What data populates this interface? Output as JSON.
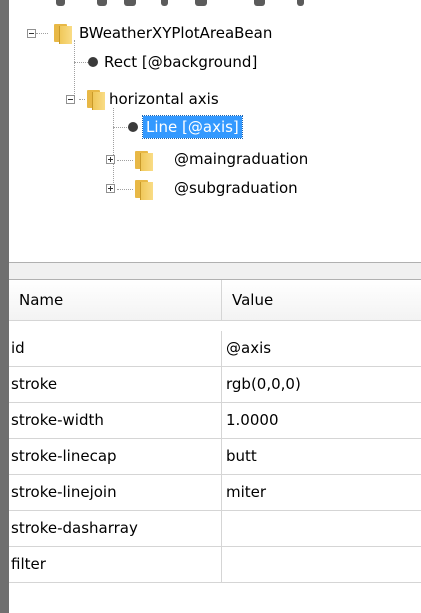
{
  "tree": {
    "nodes": [
      {
        "label": "BWeatherXYPlotAreaBean",
        "icon": "folder-icon",
        "toggle": "minus",
        "selected": false
      },
      {
        "label": "Rect [@background]",
        "icon": "leaf-dot-icon",
        "toggle": "none",
        "selected": false
      },
      {
        "label": "horizontal axis",
        "icon": "folder-icon",
        "toggle": "minus",
        "selected": false
      },
      {
        "label": "Line [@axis]",
        "icon": "leaf-dot-icon",
        "toggle": "none",
        "selected": true
      },
      {
        "label": "@maingraduation",
        "icon": "folder-icon",
        "toggle": "plus",
        "selected": false
      },
      {
        "label": "@subgraduation",
        "icon": "folder-icon",
        "toggle": "plus",
        "selected": false
      }
    ],
    "selection_color": "#3399ff",
    "folder_color": "#f0c85a"
  },
  "properties": {
    "columns": {
      "name": "Name",
      "value": "Value"
    },
    "rows": [
      {
        "name": "id",
        "value": "@axis"
      },
      {
        "name": "stroke",
        "value": "rgb(0,0,0)"
      },
      {
        "name": "stroke-width",
        "value": "1.0000"
      },
      {
        "name": "stroke-linecap",
        "value": "butt"
      },
      {
        "name": "stroke-linejoin",
        "value": "miter"
      },
      {
        "name": "stroke-dasharray",
        "value": ""
      },
      {
        "name": "filter",
        "value": ""
      }
    ]
  }
}
